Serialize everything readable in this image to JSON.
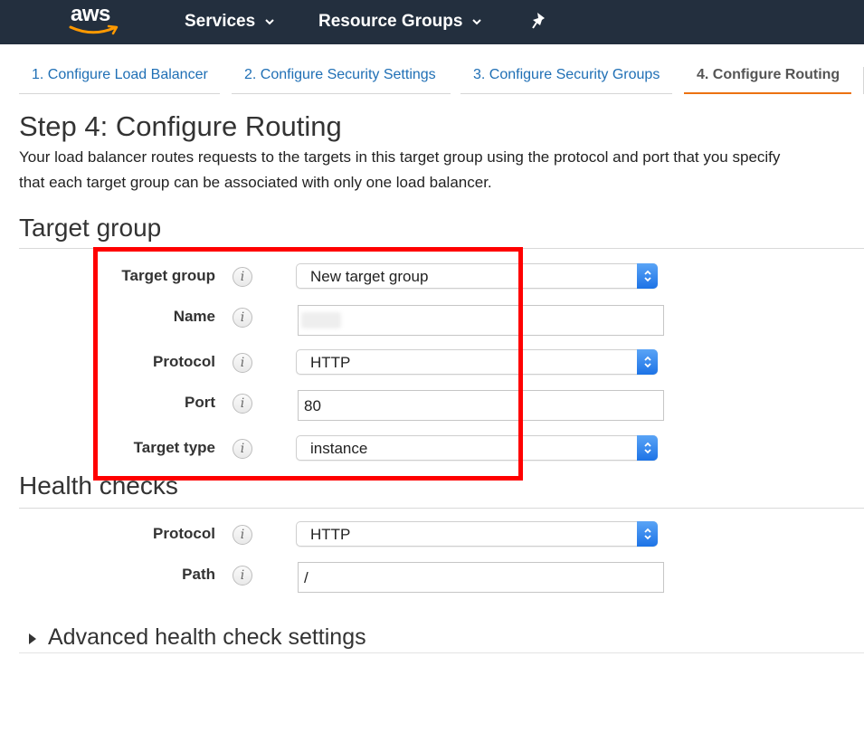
{
  "nav": {
    "logo": "aws",
    "services": "Services",
    "resource_groups": "Resource Groups"
  },
  "wizard_tabs": [
    {
      "label": "1. Configure Load Balancer",
      "active": false
    },
    {
      "label": "2. Configure Security Settings",
      "active": false
    },
    {
      "label": "3. Configure Security Groups",
      "active": false
    },
    {
      "label": "4. Configure Routing",
      "active": true
    }
  ],
  "page": {
    "title": "Step 4: Configure Routing",
    "description_line1": "Your load balancer routes requests to the targets in this target group using the protocol and port that you specify",
    "description_line2": "that each target group can be associated with only one load balancer."
  },
  "target_group": {
    "heading": "Target group",
    "fields": {
      "target_group": {
        "label": "Target group",
        "value": "New target group"
      },
      "name": {
        "label": "Name",
        "value": ""
      },
      "protocol": {
        "label": "Protocol",
        "value": "HTTP"
      },
      "port": {
        "label": "Port",
        "value": "80"
      },
      "target_type": {
        "label": "Target type",
        "value": "instance"
      }
    }
  },
  "health_checks": {
    "heading": "Health checks",
    "fields": {
      "protocol": {
        "label": "Protocol",
        "value": "HTTP"
      },
      "path": {
        "label": "Path",
        "value": "/"
      }
    }
  },
  "advanced": {
    "label": "Advanced health check settings"
  },
  "info_glyph": "i",
  "icons": {
    "logo_smile": "amazon-smile-icon",
    "nav_chevron": "chevron-down-icon",
    "pin": "pin-icon",
    "info": "info-icon",
    "select_arrows": "select-arrows-icon",
    "expand": "caret-right-icon"
  },
  "colors": {
    "nav_bg": "#232f3e",
    "link": "#1f6fb5",
    "active_tab_underline": "#ec7211",
    "highlight_box": "#ff0000",
    "select_button": "#1d73e6"
  }
}
